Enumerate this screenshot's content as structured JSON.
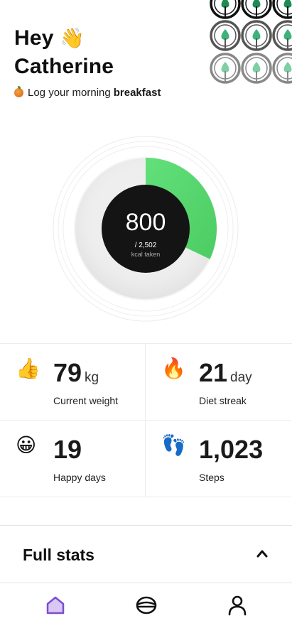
{
  "header": {
    "greeting_line1": "Hey",
    "wave_emoji": "👋",
    "greeting_line2": "Catherine",
    "prompt_prefix": "Log your morning",
    "prompt_bold": "breakfast"
  },
  "calories": {
    "taken": "800",
    "goal_text": "/ 2,502",
    "caption": "kcal taken",
    "progress_fraction": 0.32,
    "progress_color": "#5ad86e",
    "center_color": "#141414"
  },
  "stats": [
    {
      "emoji": "👍",
      "value": "79",
      "unit": "kg",
      "label": "Current weight"
    },
    {
      "emoji": "🔥",
      "value": "21",
      "unit": "day",
      "label": "Diet streak"
    },
    {
      "emoji": "😀",
      "value": "19",
      "unit": "",
      "label": "Happy days"
    },
    {
      "emoji": "👣",
      "value": "1,023",
      "unit": "",
      "label": "Steps"
    }
  ],
  "full_stats": {
    "title": "Full stats",
    "chevron_icon": "chevron-up-icon"
  },
  "nav": {
    "items": [
      {
        "icon": "home-icon",
        "active": true
      },
      {
        "icon": "food-bowl-icon",
        "active": false
      },
      {
        "icon": "profile-icon",
        "active": false
      }
    ],
    "active_color": "#7c4dce"
  },
  "colors": {
    "accent_green": "#5ad86e",
    "pattern_green": "#2ec27e",
    "text": "#111111"
  }
}
